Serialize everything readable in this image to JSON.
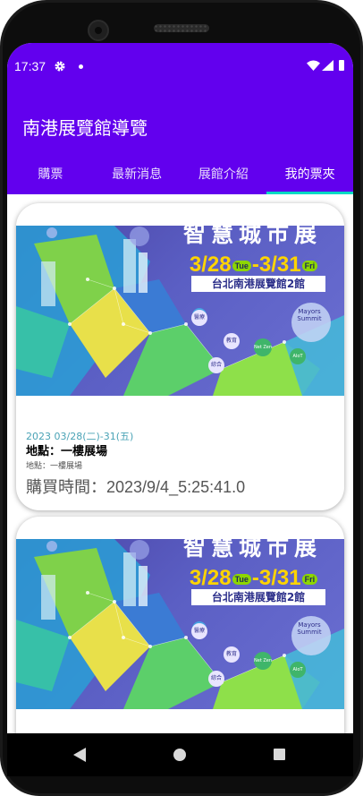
{
  "status_bar": {
    "time": "17:37",
    "icons": [
      "gear-icon",
      "notification-dot-icon",
      "wifi-icon",
      "signal-icon",
      "battery-icon"
    ]
  },
  "app_bar": {
    "title": "南港展覽館導覽",
    "color": "#6200ee"
  },
  "tabs": [
    {
      "label": "購票",
      "active": false
    },
    {
      "label": "最新消息",
      "active": false
    },
    {
      "label": "展館介紹",
      "active": false
    },
    {
      "label": "我的票夾",
      "active": true
    }
  ],
  "accent_color": "#03dac5",
  "tickets": [
    {
      "banner": {
        "title": "智慧城市展",
        "dates_start": "3/28",
        "dates_start_day": "Tue",
        "dates_end": "-3/31",
        "dates_end_day": "Fri",
        "venue": "台北南港展覽館2館",
        "chips": [
          "醫療",
          "教育",
          "Net Zero",
          "綜合",
          "AIoT",
          "Mayors Summit"
        ]
      },
      "date": "2023 03/28(二)-31(五)",
      "location": "地點：一樓展場",
      "location_sub": "地點：一樓展場",
      "purchase_time": "購買時間：2023/9/4_5:25:41.0"
    },
    {
      "banner": {
        "title": "智慧城市展",
        "dates_start": "3/28",
        "dates_start_day": "Tue",
        "dates_end": "-3/31",
        "dates_end_day": "Fri",
        "venue": "台北南港展覽館2館",
        "chips": [
          "醫療",
          "教育",
          "Net Zero",
          "綜合",
          "AIoT",
          "Mayors Summit"
        ]
      }
    }
  ],
  "nav_bar": {
    "icons": [
      "back-icon",
      "home-icon",
      "recents-icon"
    ]
  }
}
